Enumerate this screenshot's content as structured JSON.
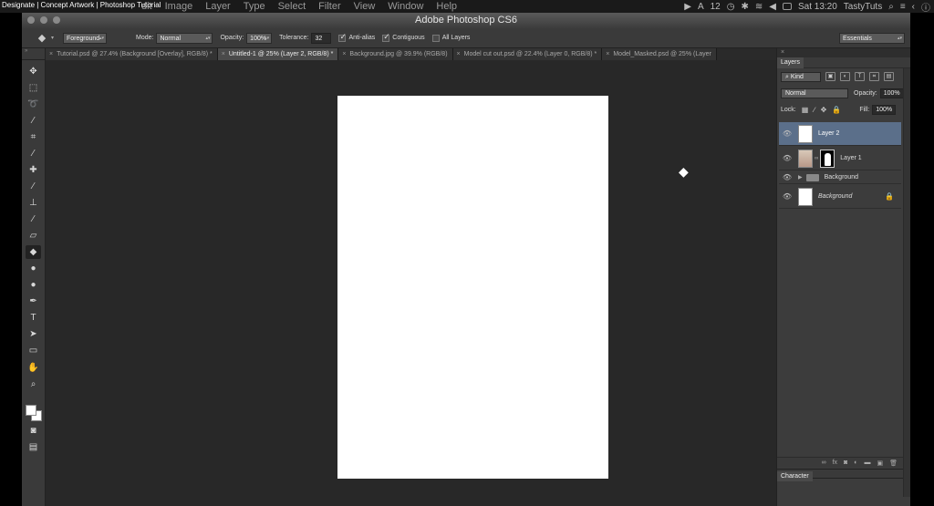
{
  "video_title": "Designate | Concept Artwork | Photoshop Tutorial",
  "menubar": {
    "items": [
      "dit",
      "Image",
      "Layer",
      "Type",
      "Select",
      "Filter",
      "View",
      "Window",
      "Help"
    ],
    "status": {
      "battery_num": "12",
      "clock": "Sat 13:20",
      "user": "TastyTuts"
    }
  },
  "app": {
    "title": "Adobe Photoshop CS6"
  },
  "options": {
    "fill_source": "Foreground",
    "mode_label": "Mode:",
    "mode_value": "Normal",
    "opacity_label": "Opacity:",
    "opacity_value": "100%",
    "tolerance_label": "Tolerance:",
    "tolerance_value": "32",
    "anti_alias": "Anti-alias",
    "contiguous": "Contiguous",
    "all_layers": "All Layers",
    "workspace": "Essentials"
  },
  "tabs": [
    {
      "label": "Tutorial.psd @ 27.4% (Background [Overlay], RGB/8) *"
    },
    {
      "label": "Untitled-1 @ 25% (Layer 2, RGB/8) *"
    },
    {
      "label": "Background.jpg @ 39.9% (RGB/8)"
    },
    {
      "label": "Model cut out.psd @ 22.4% (Layer 0, RGB/8) *"
    },
    {
      "label": "Model_Masked.psd @ 25% (Layer"
    }
  ],
  "layers_panel": {
    "tab": "Layers",
    "filter_kind": "Kind",
    "blend_mode": "Normal",
    "opacity_label": "Opacity:",
    "opacity_value": "100%",
    "lock_label": "Lock:",
    "fill_label": "Fill:",
    "fill_value": "100%",
    "layers": [
      {
        "name": "Layer 2"
      },
      {
        "name": "Layer 1"
      },
      {
        "name": "Background"
      },
      {
        "name": "Background"
      }
    ]
  },
  "character_panel": {
    "tab": "Character"
  },
  "colors": {
    "selected_layer": "#5b6f8a",
    "canvas": "#ffffff",
    "workspace": "#282828"
  }
}
